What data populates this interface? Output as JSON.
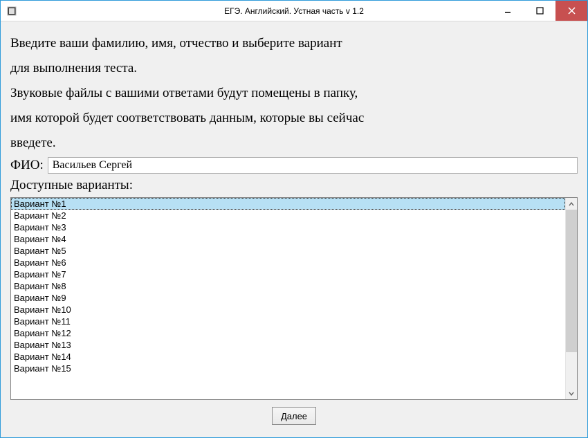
{
  "window": {
    "title": "ЕГЭ. Английский. Устная часть v 1.2"
  },
  "instructions": {
    "line1": "Введите ваши фамилию, имя, отчество и выберите вариант",
    "line2": "для выполнения теста.",
    "line3": "Звуковые файлы с вашими ответами будут помещены в папку,",
    "line4": "имя которой будет соответствовать данным, которые вы сейчас",
    "line5": "введете."
  },
  "fio": {
    "label": "ФИО:",
    "value": "Васильев Сергей"
  },
  "variants": {
    "label": "Доступные варианты:",
    "selected_index": 0,
    "items": [
      "Вариант №1",
      "Вариант №2",
      "Вариант №3",
      "Вариант №4",
      "Вариант №5",
      "Вариант №6",
      "Вариант №7",
      "Вариант №8",
      "Вариант №9",
      "Вариант №10",
      "Вариант №11",
      "Вариант №12",
      "Вариант №13",
      "Вариант №14",
      "Вариант №15"
    ]
  },
  "buttons": {
    "next": "Далее"
  }
}
